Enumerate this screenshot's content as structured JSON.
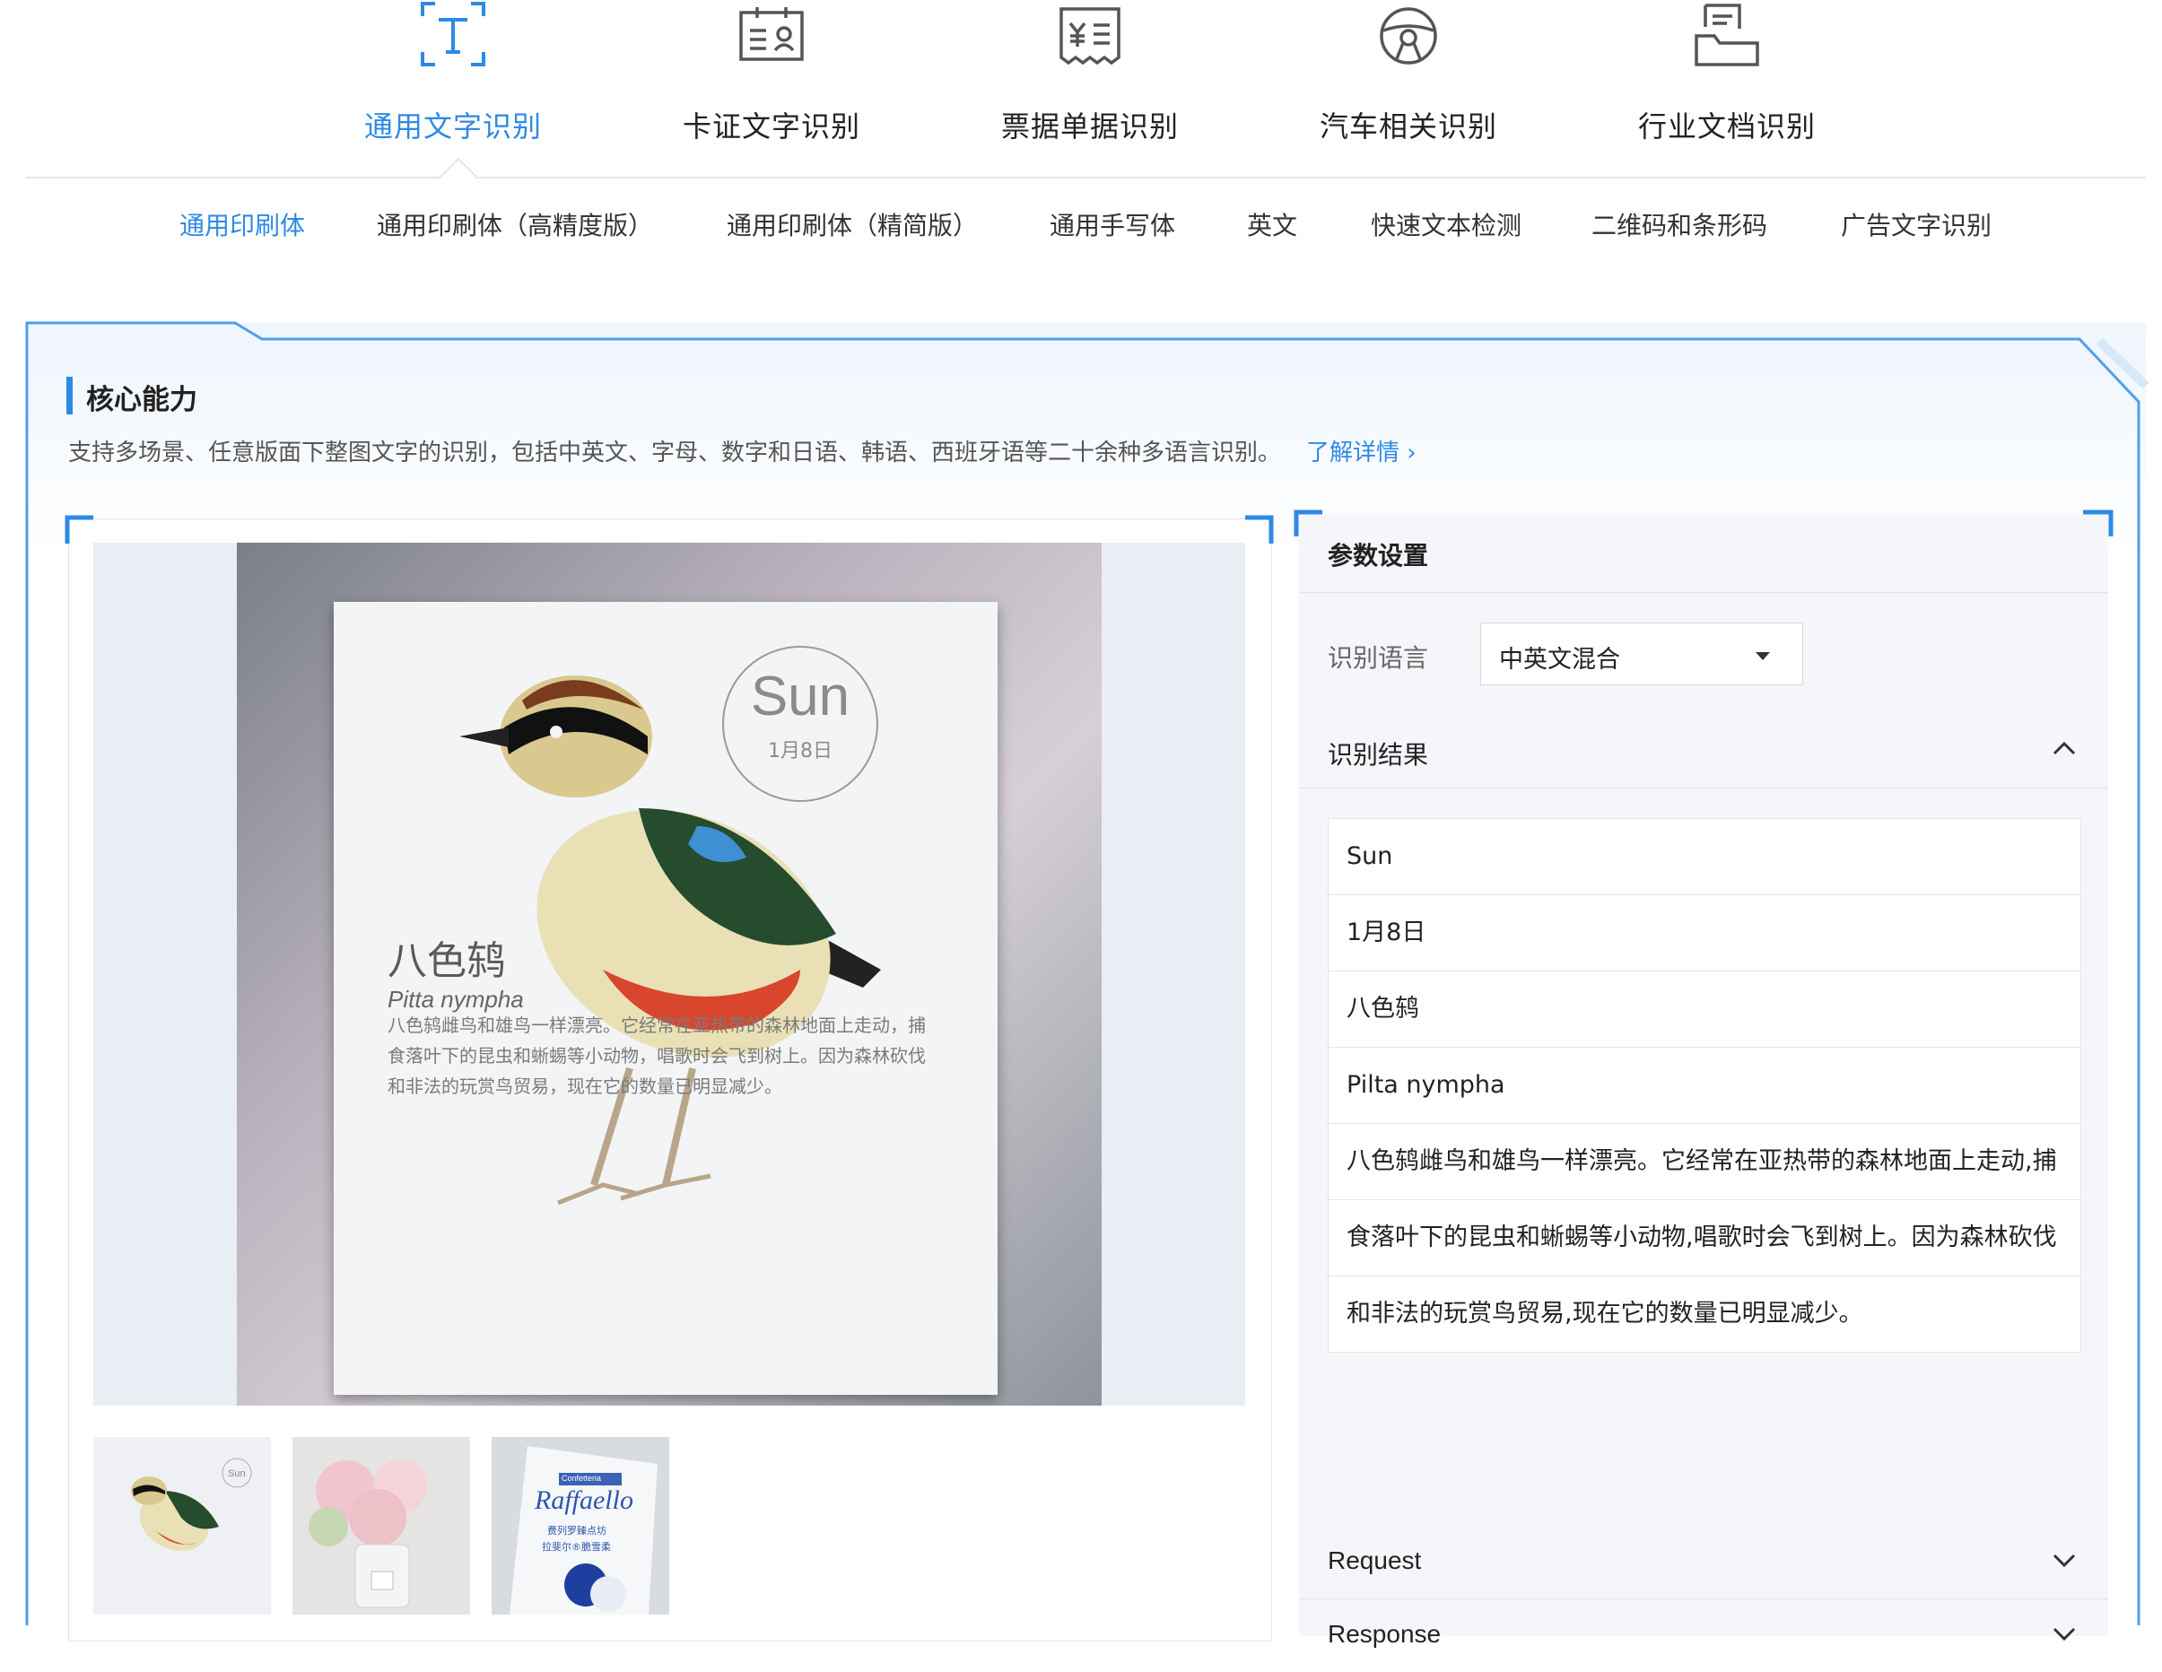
{
  "categories": [
    {
      "label": "通用文字识别",
      "icon": "text-recognition-icon",
      "active": true
    },
    {
      "label": "卡证文字识别",
      "icon": "id-card-icon",
      "active": false
    },
    {
      "label": "票据单据识别",
      "icon": "receipt-icon",
      "active": false
    },
    {
      "label": "汽车相关识别",
      "icon": "steering-wheel-icon",
      "active": false
    },
    {
      "label": "行业文档识别",
      "icon": "document-icon",
      "active": false
    }
  ],
  "subnav": [
    {
      "label": "通用印刷体",
      "active": true
    },
    {
      "label": "通用印刷体（高精度版）",
      "active": false
    },
    {
      "label": "通用印刷体（精简版）",
      "active": false
    },
    {
      "label": "通用手写体",
      "active": false
    },
    {
      "label": "英文",
      "active": false
    },
    {
      "label": "快速文本检测",
      "active": false
    },
    {
      "label": "二维码和条形码",
      "active": false
    },
    {
      "label": "广告文字识别",
      "active": false
    }
  ],
  "core": {
    "title": "核心能力",
    "description": "支持多场景、任意版面下整图文字的识别，包括中英文、字母、数字和日语、韩语、西班牙语等二十余种多语言识别。",
    "link": "了解详情"
  },
  "preview": {
    "card": {
      "day": "Sun",
      "date": "1月8日",
      "title": "八色鸫",
      "latin": "Pitta nympha",
      "lines": [
        "八色鸫雌鸟和雄鸟一样漂亮。它经常在亚热带的森林地面上走动，捕",
        "食落叶下的昆虫和蜥蜴等小动物，唱歌时会飞到树上。因为森林砍伐",
        "和非法的玩赏鸟贸易，现在它的数量已明显减少。"
      ]
    },
    "thumbnails": [
      {
        "name": "bird-calendar",
        "active": true
      },
      {
        "name": "flowers-vase",
        "active": false
      },
      {
        "name": "raffaello-box",
        "active": false,
        "text1": "Raffaello",
        "text2": "费列罗臻点坊",
        "text3": "拉斐尔®脆雪柔",
        "badge": "Confetteria"
      }
    ]
  },
  "params": {
    "title": "参数设置",
    "language_label": "识别语言",
    "language_value": "中英文混合"
  },
  "results": {
    "title": "识别结果",
    "items": [
      "Sun",
      "1月8日",
      "八色鸫",
      "Pilta nympha",
      "八色鸫雌鸟和雄鸟一样漂亮。它经常在亚热带的森林地面上走动,捕",
      "食落叶下的昆虫和蜥蜴等小动物,唱歌时会飞到树上。因为森林砍伐",
      "和非法的玩赏鸟贸易,现在它的数量已明显减少。"
    ]
  },
  "request": {
    "title": "Request"
  },
  "response": {
    "title": "Response"
  },
  "colors": {
    "accent": "#2e89e6",
    "panel": "#f4f6fa"
  }
}
